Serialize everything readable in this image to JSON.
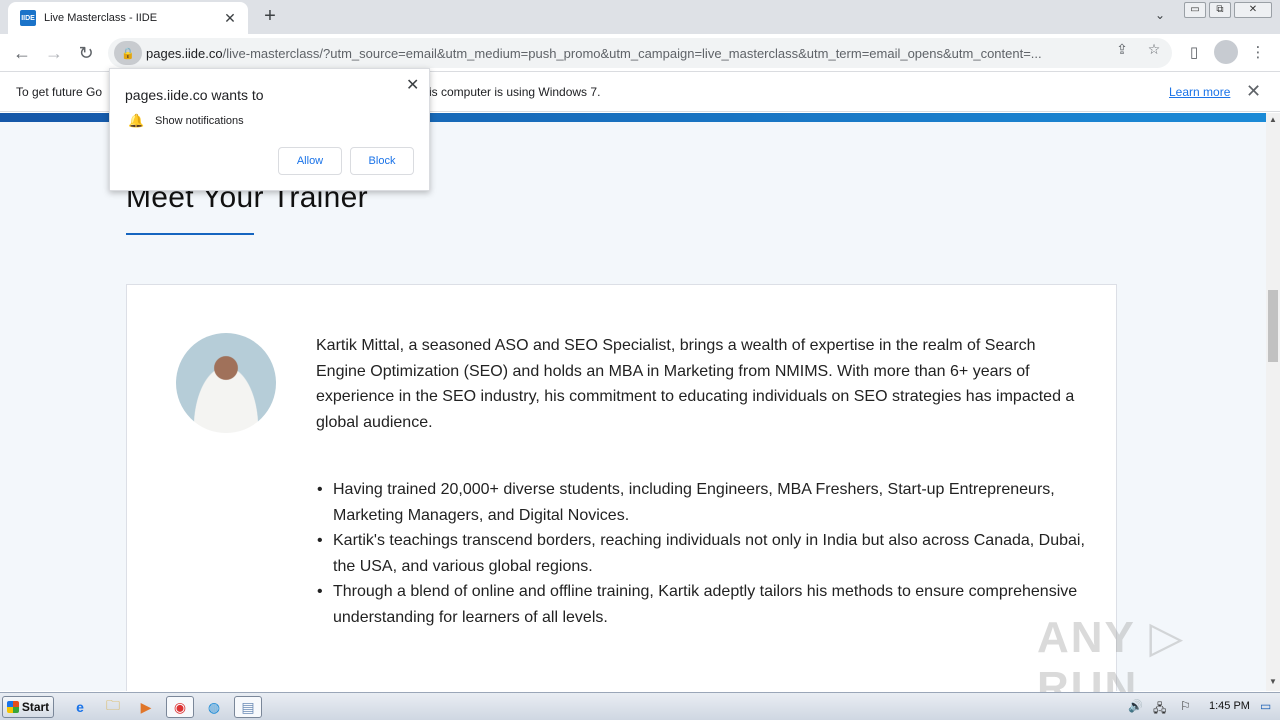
{
  "browser": {
    "tab": {
      "favicon_text": "IIDE",
      "title": "Live Masterclass - IIDE",
      "close_glyph": "✕"
    },
    "new_tab_glyph": "+",
    "tab_search_glyph": "⌄",
    "window_controls": {
      "minimize": "▭",
      "restore": "⧉",
      "close": "✕"
    },
    "nav": {
      "back": "←",
      "forward": "→",
      "reload": "↻"
    },
    "url_host": "pages.iide.co",
    "url_path": "/live-masterclass/?utm_source=email&utm_medium=push_promo&utm_campaign=live_masterclass&utm_term=email_opens&utm_content=...",
    "icons": {
      "share": "⇪",
      "star": "☆",
      "sidepanel": "▯",
      "menu": "⋮",
      "lock": "🔒"
    }
  },
  "infobar": {
    "text_start": "To get future Go",
    "text_end": "is computer is using Windows 7.",
    "learn_more": "Learn more",
    "close_glyph": "✕"
  },
  "popup": {
    "title": "pages.iide.co wants to",
    "permission": "Show notifications",
    "allow": "Allow",
    "block": "Block",
    "close_glyph": "✕",
    "bell_glyph": "🔔"
  },
  "page": {
    "heading": "Meet Your Trainer",
    "bio": "Kartik Mittal, a seasoned ASO and SEO Specialist, brings a wealth of expertise in the realm of Search Engine Optimization (SEO) and holds an MBA in Marketing from NMIMS. With more than 6+ years of experience in the SEO industry, his commitment to educating individuals on SEO strategies has impacted a global audience.",
    "bullets": [
      "Having trained 20,000+ diverse students, including Engineers, MBA Freshers, Start-up Entrepreneurs, Marketing Managers, and Digital Novices.",
      "Kartik's teachings transcend borders, reaching individuals not only in India but also across Canada, Dubai, the USA, and various global regions.",
      "Through a blend of online and offline training, Kartik adeptly tailors his methods to ensure comprehensive understanding for learners of all levels."
    ]
  },
  "scrollbar": {
    "up": "▲",
    "down": "▼"
  },
  "watermark": "ANY ▷ RUN",
  "taskbar": {
    "start_label": "Start",
    "icons": {
      "ie": "e",
      "explorer": "🗀",
      "media": "▶",
      "chrome": "◉",
      "edge": "◍",
      "notepad": "▤"
    },
    "tray": {
      "volume": "🔊",
      "network": "🖧",
      "flag": "⚐",
      "display": "▭"
    },
    "clock": "1:45 PM"
  }
}
